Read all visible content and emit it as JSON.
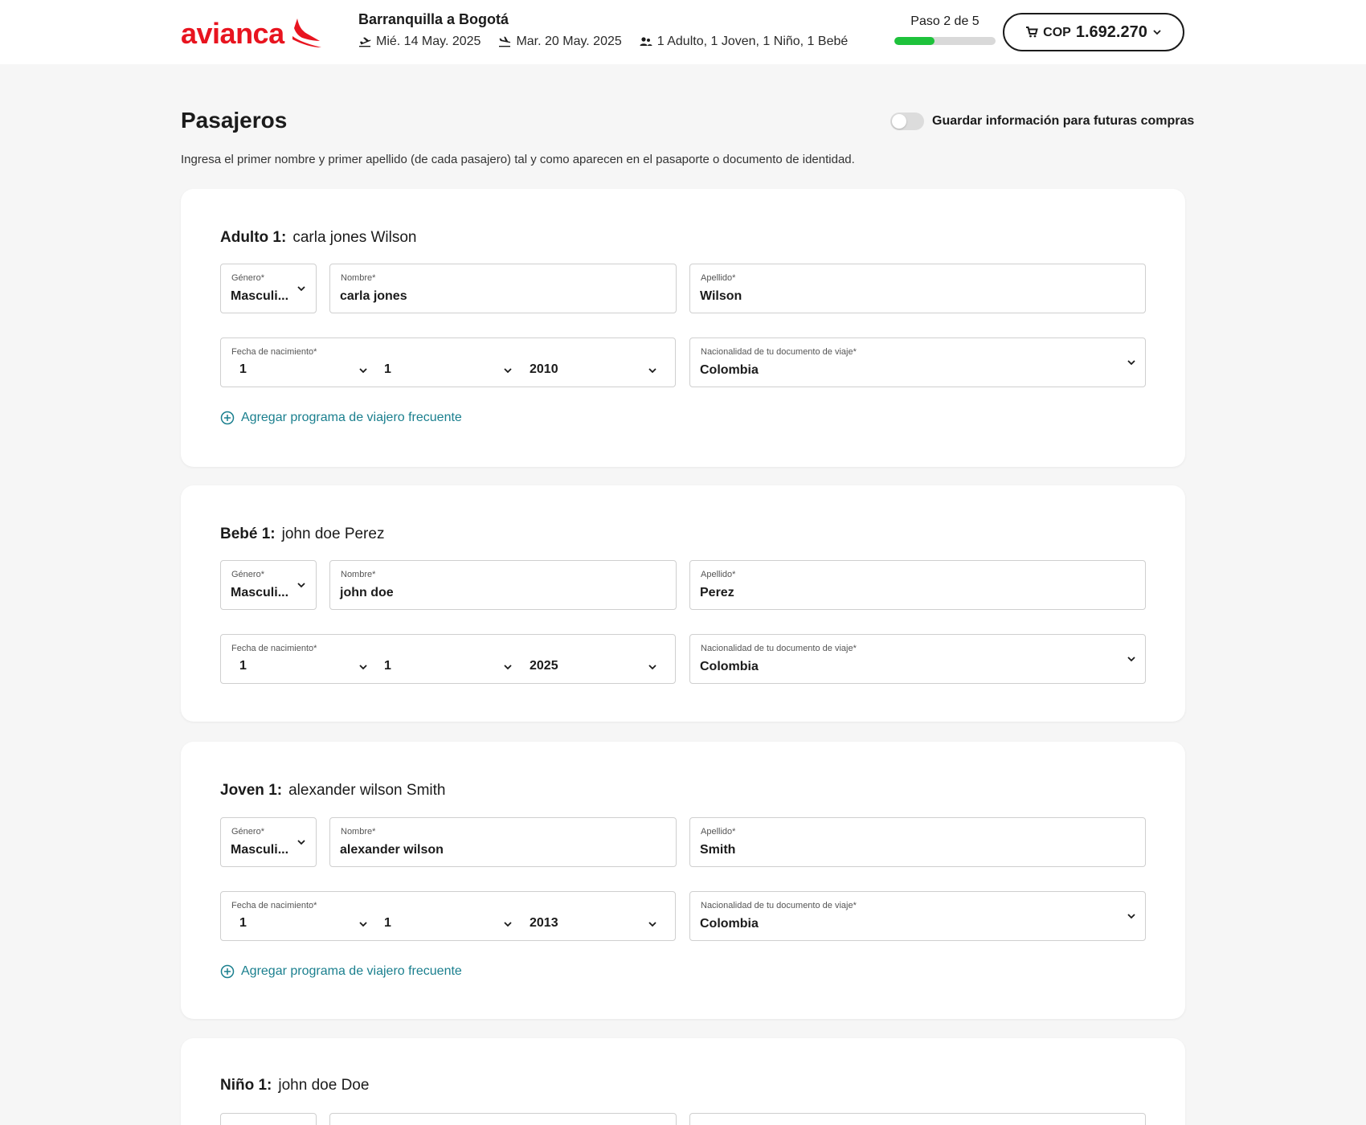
{
  "header": {
    "logo_text": "avianca",
    "route": "Barranquilla a Bogotá",
    "depart_date": "Mié. 14 May. 2025",
    "return_date": "Mar. 20 May. 2025",
    "passengers": "1 Adulto, 1 Joven, 1 Niño, 1 Bebé",
    "step_label": "Paso 2 de 5",
    "step_progress": 0.4,
    "cart_currency": "COP",
    "cart_amount": "1.692.270",
    "colors": {
      "brand": "#e8141f",
      "progress": "#1ec23b",
      "link": "#1a7f8e"
    }
  },
  "page": {
    "title": "Pasajeros",
    "save_toggle_label": "Guardar información para futuras compras",
    "save_toggle_on": false,
    "instructions": "Ingresa el primer nombre y primer apellido (de cada pasajero) tal y como aparecen en el pasaporte o documento de identidad."
  },
  "labels": {
    "gender": "Género*",
    "first_name": "Nombre*",
    "last_name": "Apellido*",
    "birthdate": "Fecha de nacimiento*",
    "nationality": "Nacionalidad de tu documento de viaje*",
    "ffp_link": "Agregar programa de viajero frecuente"
  },
  "passengers": [
    {
      "type": "Adulto 1:",
      "full_name": "carla jones Wilson",
      "gender": "Masculi...",
      "first_name": "carla jones",
      "last_name": "Wilson",
      "day": "1",
      "month": "1",
      "year": "2010",
      "nationality": "Colombia"
    },
    {
      "type": "Bebé 1:",
      "full_name": "john doe Perez",
      "gender": "Masculi...",
      "first_name": "john doe",
      "last_name": "Perez",
      "day": "1",
      "month": "1",
      "year": "2025",
      "nationality": "Colombia"
    },
    {
      "type": "Joven 1:",
      "full_name": "alexander wilson Smith",
      "gender": "Masculi...",
      "first_name": "alexander wilson",
      "last_name": "Smith",
      "day": "1",
      "month": "1",
      "year": "2013",
      "nationality": "Colombia"
    },
    {
      "type": "Niño 1:",
      "full_name": "john doe Doe"
    }
  ],
  "icons": {
    "depart": "plane-takeoff-icon",
    "return": "plane-landing-icon",
    "passengers": "passengers-icon",
    "cart": "cart-icon",
    "dropdown": "chevron-down-icon",
    "add": "plus-circle-icon"
  }
}
